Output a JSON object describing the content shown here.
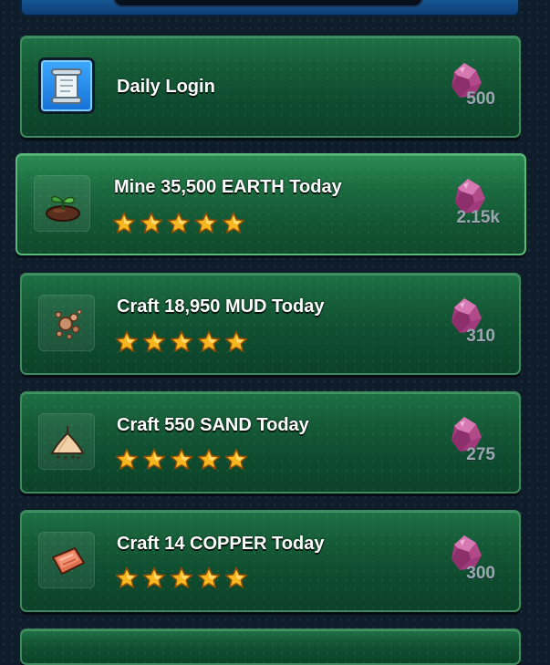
{
  "quests": [
    {
      "title": "Daily Login",
      "reward": "500",
      "icon": "scroll-icon",
      "stars": 0
    },
    {
      "title": "Mine 35,500 EARTH Today",
      "reward": "2.15k",
      "icon": "earth-sprout-icon",
      "stars": 5
    },
    {
      "title": "Craft 18,950 MUD Today",
      "reward": "310",
      "icon": "mud-splash-icon",
      "stars": 5
    },
    {
      "title": "Craft 550 SAND Today",
      "reward": "275",
      "icon": "sand-pile-icon",
      "stars": 5
    },
    {
      "title": "Craft 14 COPPER Today",
      "reward": "300",
      "icon": "copper-ingot-icon",
      "stars": 5
    }
  ],
  "reward_icon": "gem-icon",
  "colors": {
    "card_green": "#145936",
    "star_gold": "#f7b51e",
    "gem_purple": "#b24a8a",
    "reward_text": "#9aa8b0"
  }
}
